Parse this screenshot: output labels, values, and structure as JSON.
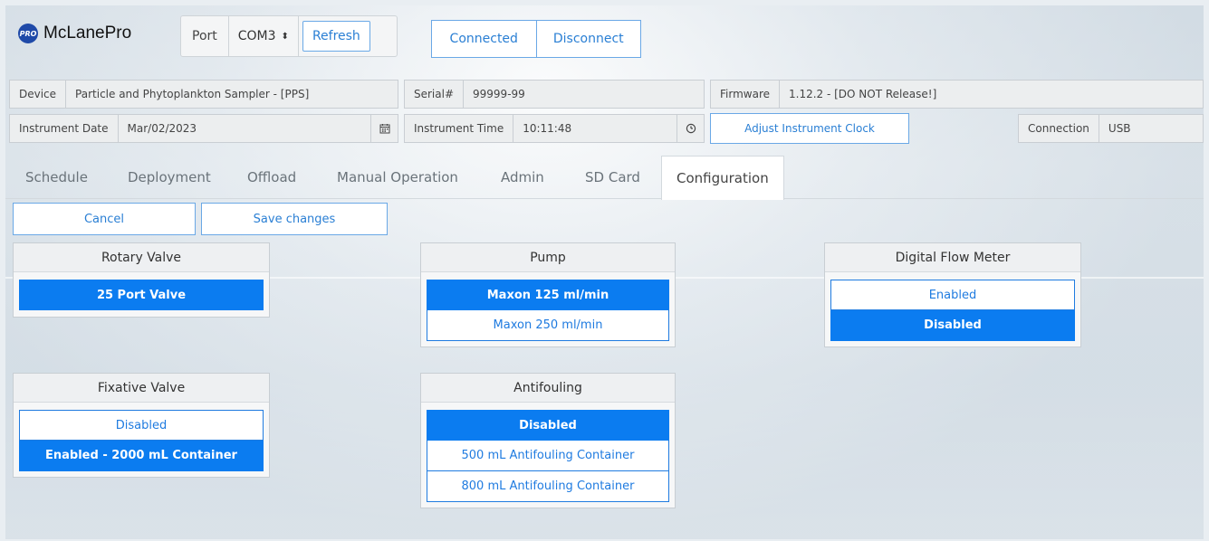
{
  "app": {
    "name": "McLanePro",
    "badge": "PRO"
  },
  "port": {
    "label": "Port",
    "value": "COM3",
    "arrows": "⬍",
    "refresh_label": "Refresh"
  },
  "connection_buttons": {
    "connected": "Connected",
    "disconnect": "Disconnect"
  },
  "info": {
    "device_label": "Device",
    "device_value": "Particle and Phytoplankton Sampler - [PPS]",
    "serial_label": "Serial#",
    "serial_value": "99999-99",
    "firmware_label": "Firmware",
    "firmware_value": "1.12.2 - [DO NOT Release!]",
    "date_label": "Instrument Date",
    "date_value": "Mar/02/2023",
    "time_label": "Instrument Time",
    "time_value": "10:11:48",
    "adjust_label": "Adjust Instrument Clock",
    "connection_label": "Connection",
    "connection_value": "USB"
  },
  "tabs": [
    "Schedule",
    "Deployment",
    "Offload",
    "Manual Operation",
    "Admin",
    "SD Card",
    "Configuration"
  ],
  "active_tab": "Configuration",
  "actions": {
    "cancel": "Cancel",
    "save": "Save changes"
  },
  "panels": {
    "rotary_valve": {
      "title": "Rotary Valve",
      "options": [
        "25 Port Valve"
      ],
      "selected": 0
    },
    "pump": {
      "title": "Pump",
      "options": [
        "Maxon 125 ml/min",
        "Maxon 250 ml/min"
      ],
      "selected": 0
    },
    "flow_meter": {
      "title": "Digital Flow Meter",
      "options": [
        "Enabled",
        "Disabled"
      ],
      "selected": 1
    },
    "fixative_valve": {
      "title": "Fixative Valve",
      "options": [
        "Disabled",
        "Enabled - 2000 mL Container"
      ],
      "selected": 1
    },
    "antifouling": {
      "title": "Antifouling",
      "options": [
        "Disabled",
        "500 mL Antifouling Container",
        "800 mL Antifouling Container"
      ],
      "selected": 0
    }
  },
  "colors": {
    "accent": "#0b7cf0",
    "link": "#2a7fd4",
    "logo": "#1f4aa8"
  }
}
